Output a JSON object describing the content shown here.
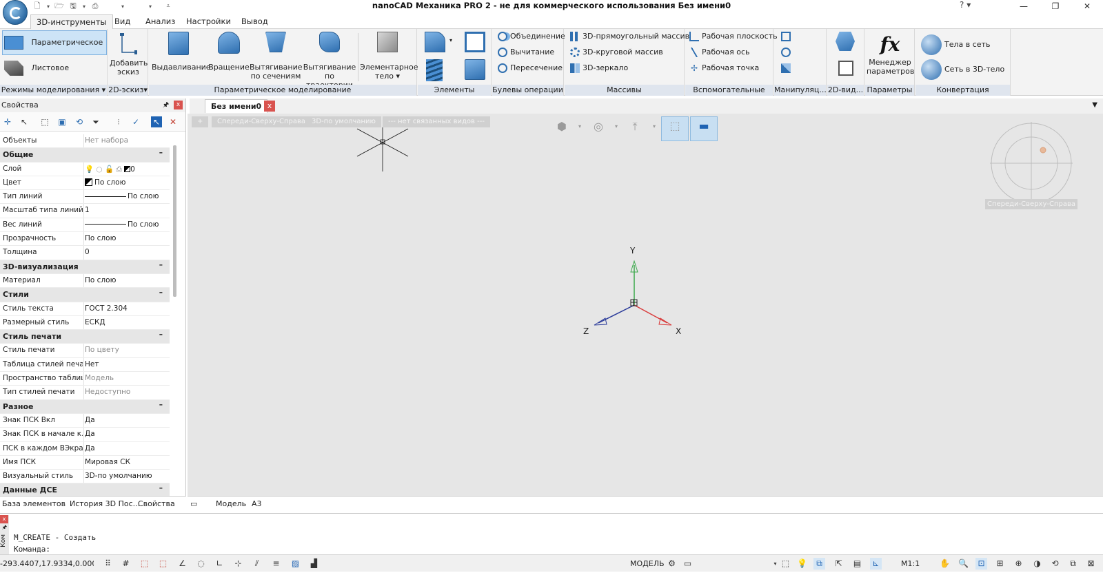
{
  "window": {
    "title": "nanoCAD Механика PRO 2 - не для коммерческого использования Без имени0",
    "help": "?",
    "minimize": "—",
    "restore": "❐",
    "close": "✕"
  },
  "menu": {
    "tabs": [
      "3D-инструменты",
      "Вид",
      "Анализ",
      "Настройки",
      "Вывод"
    ]
  },
  "ribbon": {
    "modes": {
      "parametric": "Параметрическое",
      "sheet": "Листовое",
      "label": "Режимы моделирования"
    },
    "sketch": {
      "add_line1": "Добавить",
      "add_line2": "эскиз",
      "label": "2D-эскиз"
    },
    "param": {
      "extrude": "Выдавливание",
      "rotate": "Вращение",
      "loft_line1": "Вытягивание",
      "loft_line2": "по сечениям",
      "sweep_line1": "Вытягивание",
      "sweep_line2": "по траектории",
      "label": "Параметрическое моделирование"
    },
    "elements": {
      "primitive_line1": "Элементарное",
      "primitive_line2": "тело",
      "label": "Элементы"
    },
    "boolean": {
      "union": "Объединение",
      "subtract": "Вычитание",
      "intersect": "Пересечение",
      "label": "Булевы операции"
    },
    "arrays": {
      "rect": "3D-прямоугольный массив",
      "circ": "3D-круговой массив",
      "mirror": "3D-зеркало",
      "label": "Массивы"
    },
    "aux": {
      "plane": "Рабочая плоскость",
      "axis": "Рабочая ось",
      "point": "Рабочая точка",
      "label": "Вспомогательные"
    },
    "manip": {
      "label": "Манипуляц..."
    },
    "view2d": {
      "label": "2D-вид..."
    },
    "params": {
      "fx": "fx",
      "mgr_line1": "Менеджер",
      "mgr_line2": "параметров",
      "label": "Параметры"
    },
    "convert": {
      "to_mesh": "Тела в сеть",
      "to_solid": "Сеть в 3D-тело",
      "label": "Конвертация"
    }
  },
  "document": {
    "tab": "Без имени0",
    "close": "x"
  },
  "properties": {
    "title": "Свойства",
    "pin": "🖈",
    "close": "x",
    "rows": [
      {
        "k": "Объекты",
        "v": "Нет набора",
        "dim": true
      },
      {
        "k": "Общие",
        "section": true
      },
      {
        "k": "Слой",
        "v": "0",
        "layer": true
      },
      {
        "k": "Цвет",
        "v": "По слою",
        "swatch": true
      },
      {
        "k": "Тип линий",
        "v": "По слою",
        "line": true
      },
      {
        "k": "Масштаб типа линий",
        "v": "1"
      },
      {
        "k": "Вес линий",
        "v": "По слою",
        "line": true
      },
      {
        "k": "Прозрачность",
        "v": "По слою"
      },
      {
        "k": "Толщина",
        "v": "0"
      },
      {
        "k": "3D-визуализация",
        "section": true
      },
      {
        "k": "Материал",
        "v": "По слою"
      },
      {
        "k": "Стили",
        "section": true
      },
      {
        "k": "Стиль текста",
        "v": "ГОСТ 2.304"
      },
      {
        "k": "Размерный стиль",
        "v": "ЕСКД"
      },
      {
        "k": "Стиль печати",
        "section": true
      },
      {
        "k": "Стиль печати",
        "v": "По цвету",
        "dim": true
      },
      {
        "k": "Таблица стилей печати",
        "v": "Нет"
      },
      {
        "k": "Пространство таблиц...",
        "v": "Модель",
        "dim": true
      },
      {
        "k": "Тип стилей печати",
        "v": "Недоступно",
        "dim": true
      },
      {
        "k": "Разное",
        "section": true
      },
      {
        "k": "Знак ПСК Вкл",
        "v": "Да"
      },
      {
        "k": "Знак ПСК в начале к...",
        "v": "Да"
      },
      {
        "k": "ПСК в каждом ВЭкране",
        "v": "Да"
      },
      {
        "k": "Имя ПСК",
        "v": "Мировая СК"
      },
      {
        "k": "Визуальный стиль",
        "v": "3D-по умолчанию"
      },
      {
        "k": "Данные ДСЕ",
        "section": true
      }
    ],
    "collapse": "–"
  },
  "left_tabs": [
    "База элементов",
    "История 3D Пос...",
    "Свойства"
  ],
  "viewport": {
    "chips": [
      "+",
      "Спереди-Сверху-Справа",
      "3D-по умолчанию",
      "--- нет связанных видов ---"
    ],
    "cube_label": "Спереди-Сверху-Справа",
    "axes": {
      "x": "X",
      "y": "Y",
      "z": "Z"
    }
  },
  "model_tabs": [
    "Модель",
    "А3"
  ],
  "command": {
    "side_label": "Ком",
    "line1": "M_CREATE  -  Создать",
    "line2": "Команда:"
  },
  "status": {
    "coords": "-293.4407,17.9334,0.0000",
    "space": "МОДЕЛЬ",
    "scale": "М1:1"
  }
}
